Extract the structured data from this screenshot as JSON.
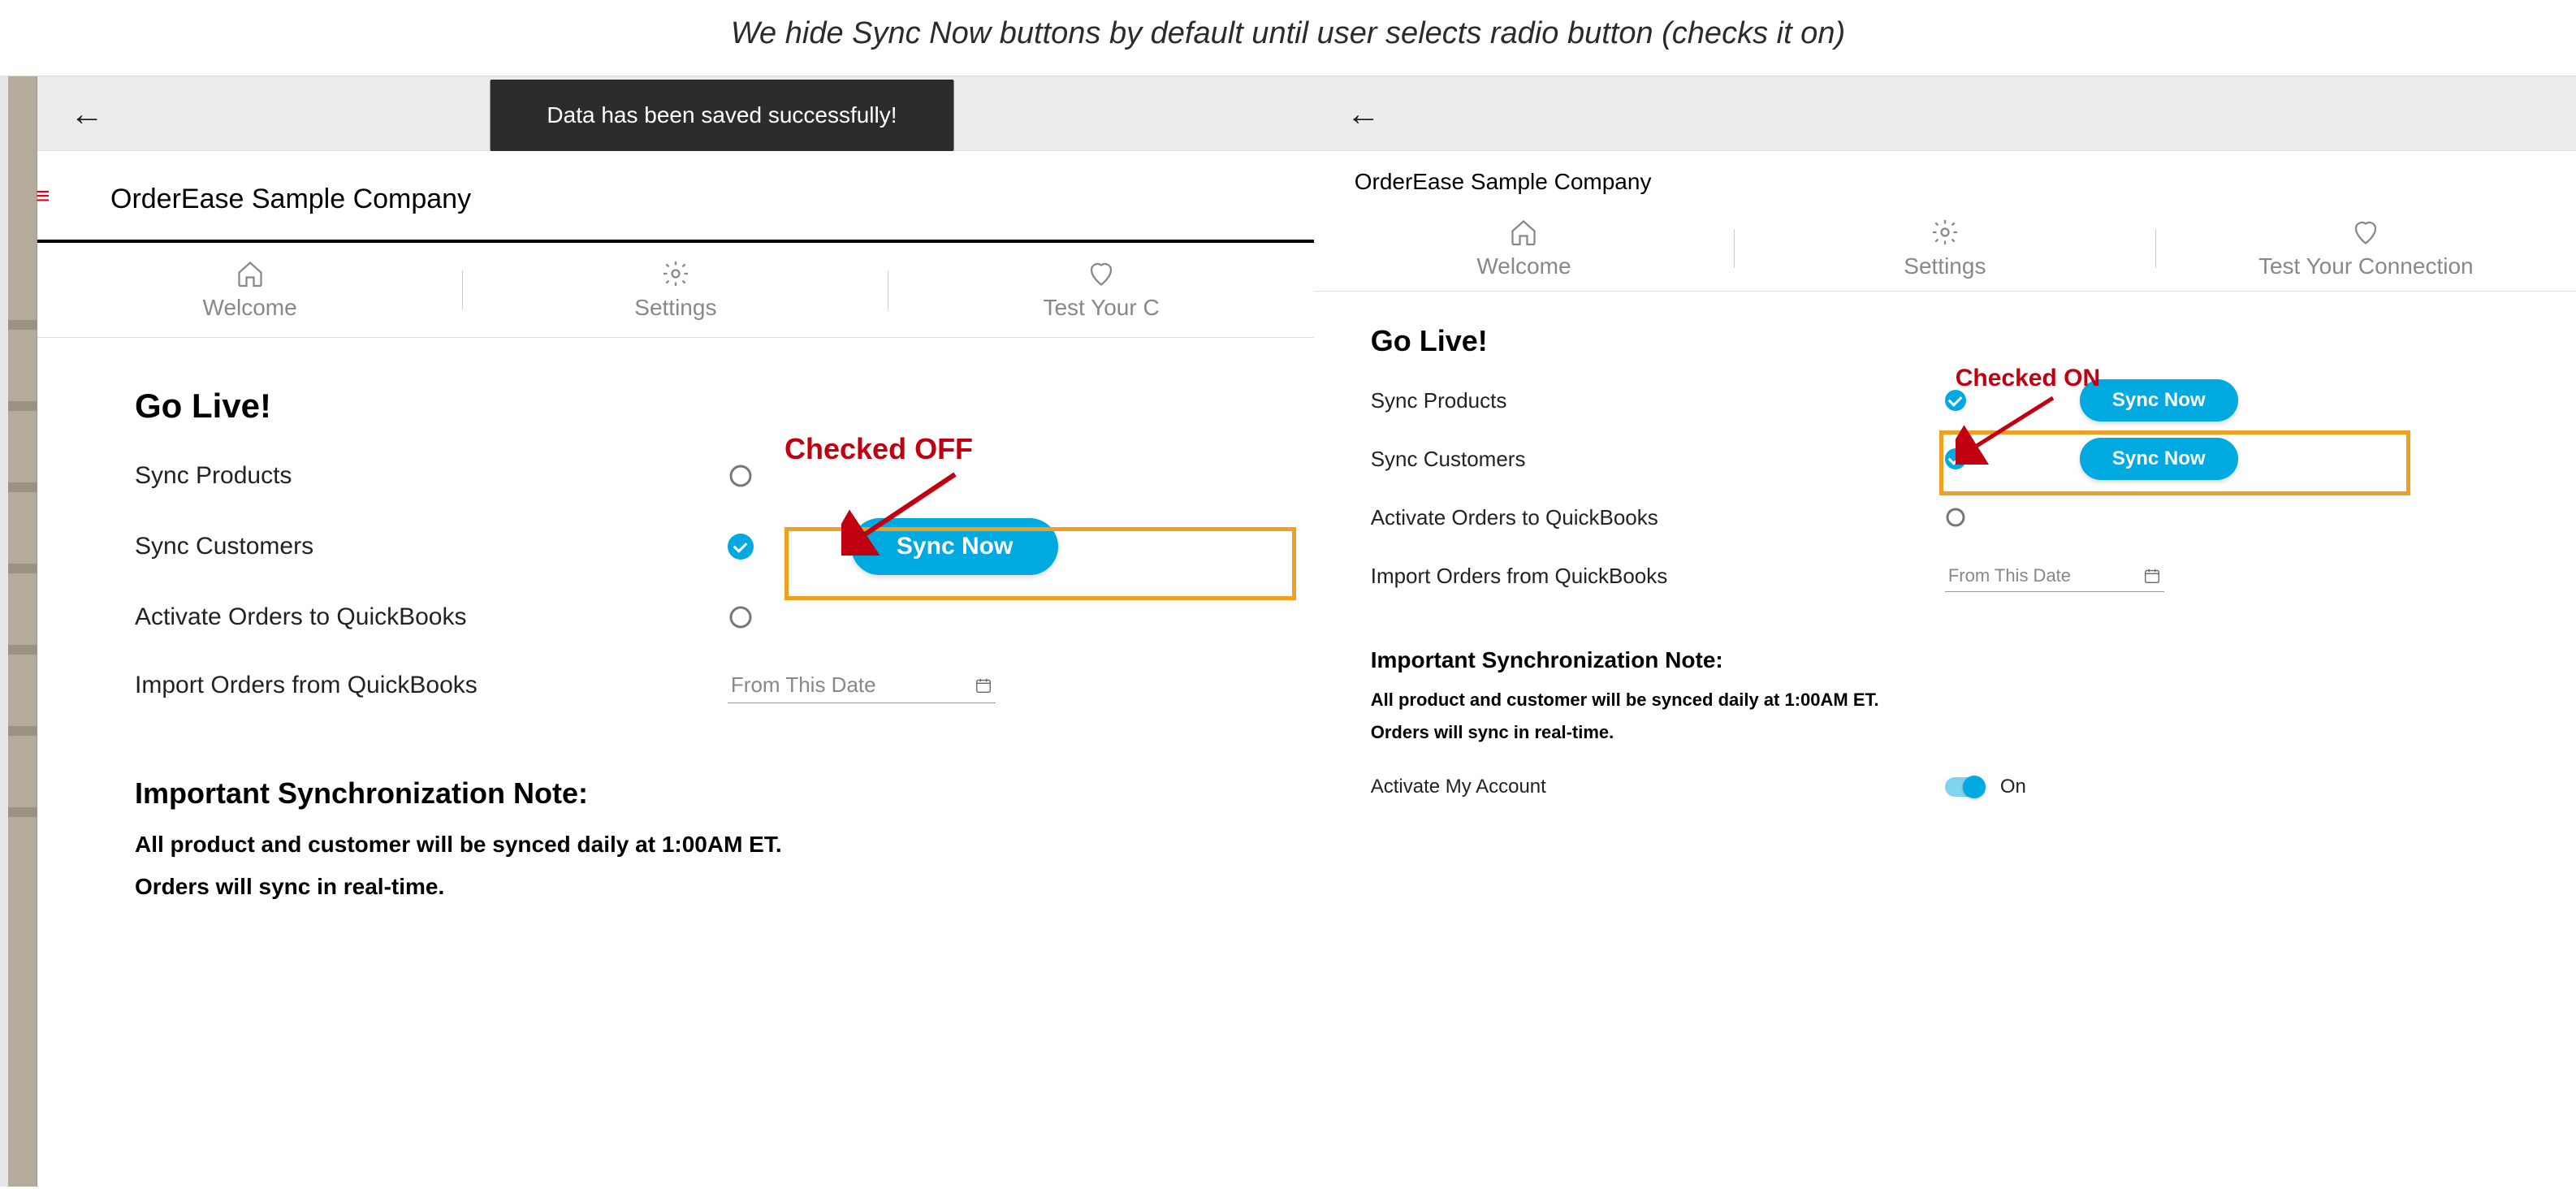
{
  "caption": "We hide Sync Now buttons by default until user selects radio button (checks it on)",
  "toast": "Data has been saved successfully!",
  "company_name": "OrderEase Sample Company",
  "tabs": {
    "welcome": "Welcome",
    "settings": "Settings",
    "test_connection_short": "Test Your C",
    "test_connection": "Test Your Connection"
  },
  "golive": {
    "heading": "Go Live!",
    "sync_products": "Sync Products",
    "sync_customers": "Sync Customers",
    "activate_orders": "Activate Orders to QuickBooks",
    "import_orders": "Import Orders from QuickBooks",
    "date_placeholder": "From This Date",
    "sync_now": "Sync Now"
  },
  "note": {
    "heading": "Important Synchronization Note:",
    "line1": "All product and customer will be synced daily at 1:00AM ET.",
    "line2": "Orders will sync in real-time."
  },
  "activate_account": {
    "label": "Activate My Account",
    "state": "On"
  },
  "annotations": {
    "checked_off": "Checked OFF",
    "checked_on": "Checked ON"
  },
  "left_states": {
    "sync_products": false,
    "sync_customers": true,
    "activate_orders": false
  },
  "right_states": {
    "sync_products": true,
    "sync_customers": true,
    "activate_orders": false
  }
}
